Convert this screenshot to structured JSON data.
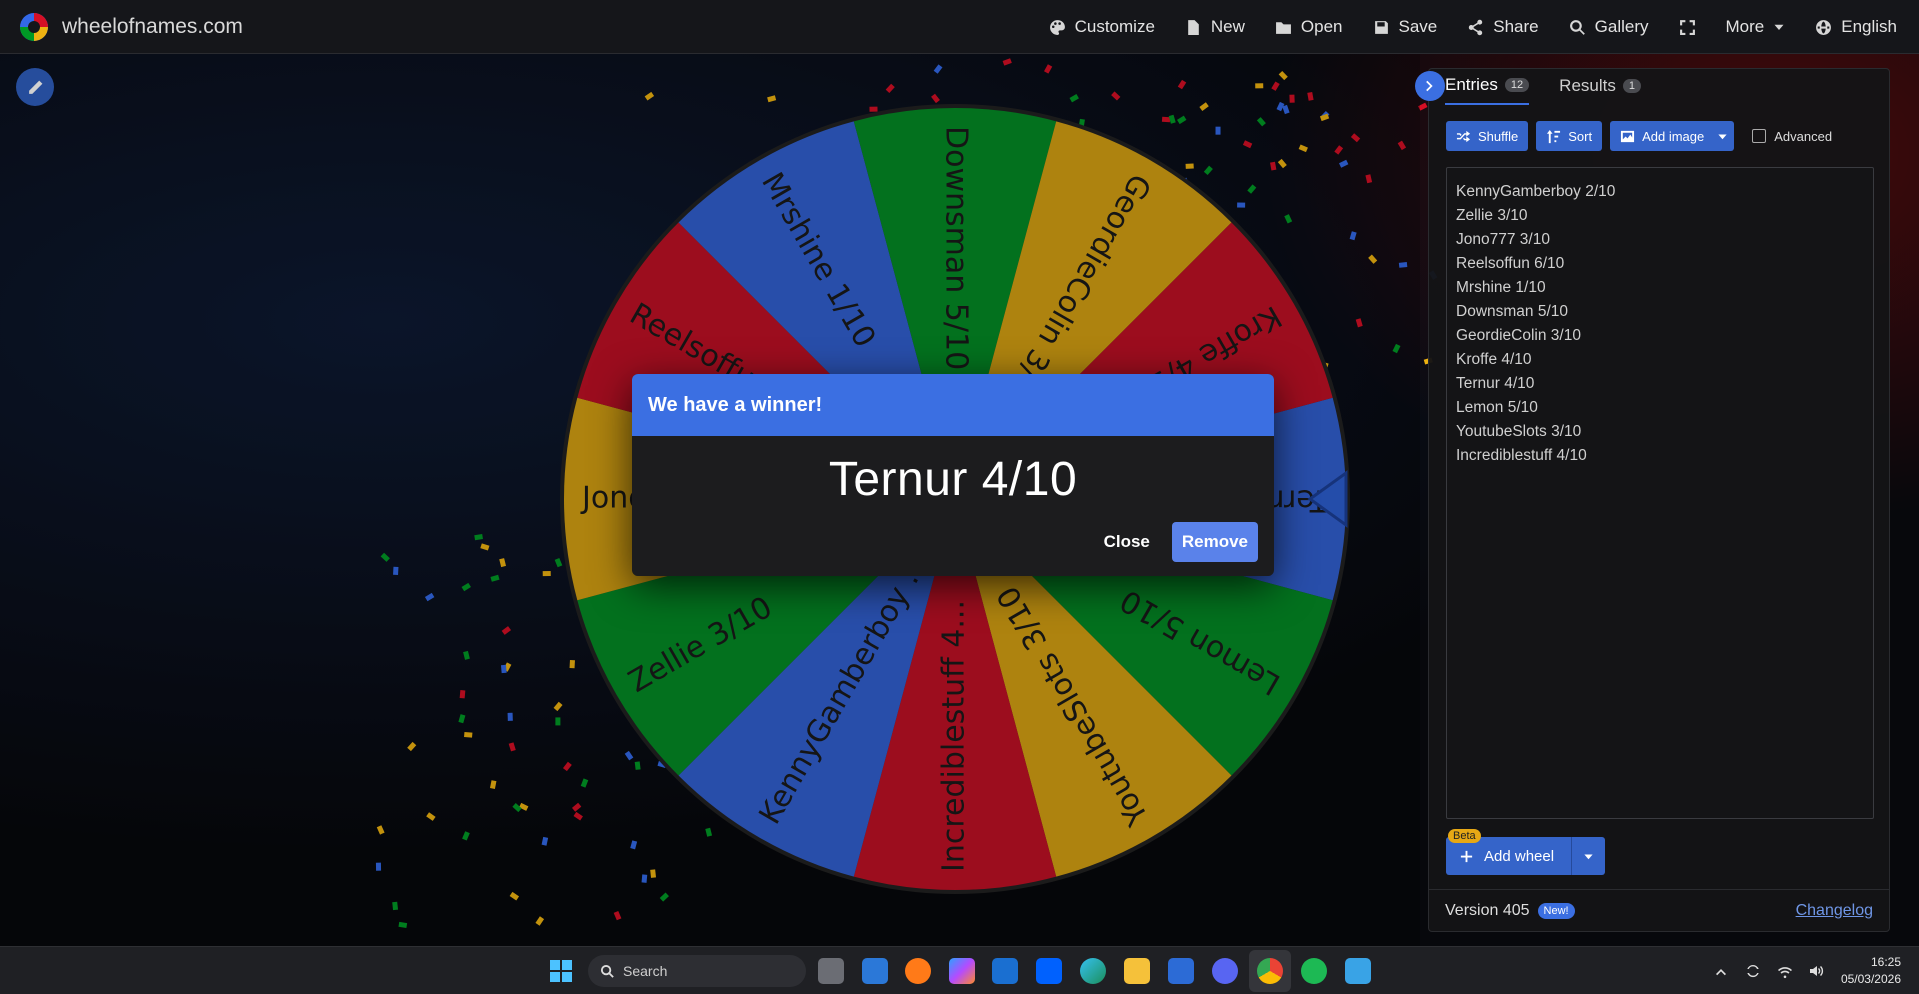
{
  "app": {
    "name": "wheelofnames.com"
  },
  "menu": [
    {
      "label": "Customize",
      "icon": "palette-icon"
    },
    {
      "label": "New",
      "icon": "file-icon"
    },
    {
      "label": "Open",
      "icon": "folder-icon"
    },
    {
      "label": "Save",
      "icon": "save-icon"
    },
    {
      "label": "Share",
      "icon": "share-icon"
    },
    {
      "label": "Gallery",
      "icon": "search-icon"
    },
    {
      "label": "",
      "icon": "fullscreen-icon"
    },
    {
      "label": "More",
      "icon": "caret-down-icon"
    },
    {
      "label": "English",
      "icon": "globe-icon"
    }
  ],
  "wheel": {
    "colors": [
      "#3369e8",
      "#009925",
      "#eeb211",
      "#d50f25"
    ],
    "slices": [
      "Ternur 4/10",
      "Lemon 5/10",
      "YoutubeSlots 3/10",
      "Incrediblestuff 4...",
      "KennyGamberboy ...",
      "Zellie 3/10",
      "Jono777 3/10",
      "Reelsoffun 6/10",
      "Mrshine 1/10",
      "Downsman 5/10",
      "GeordieColin 3/10",
      "Kroffe 4/10"
    ]
  },
  "modal": {
    "title": "We have a winner!",
    "winner": "Ternur 4/10",
    "close_label": "Close",
    "remove_label": "Remove"
  },
  "panel": {
    "tabs": [
      {
        "label": "Entries",
        "count": "12"
      },
      {
        "label": "Results",
        "count": "1"
      }
    ],
    "toolbar": {
      "shuffle": "Shuffle",
      "sort": "Sort",
      "add_image": "Add image",
      "advanced": "Advanced"
    },
    "entries": [
      "KennyGamberboy 2/10",
      "Zellie 3/10",
      "Jono777 3/10",
      "Reelsoffun 6/10",
      "Mrshine 1/10",
      "Downsman 5/10",
      "GeordieColin 3/10",
      "Kroffe 4/10",
      "Ternur 4/10",
      "Lemon 5/10",
      "YoutubeSlots 3/10",
      "Incrediblestuff 4/10"
    ],
    "add_wheel": "Add wheel",
    "beta": "Beta",
    "version": "Version 405",
    "new_badge": "New!",
    "changelog": "Changelog"
  },
  "taskbar": {
    "search_placeholder": "Search",
    "time": "16:25",
    "date": "05/03/2026"
  }
}
